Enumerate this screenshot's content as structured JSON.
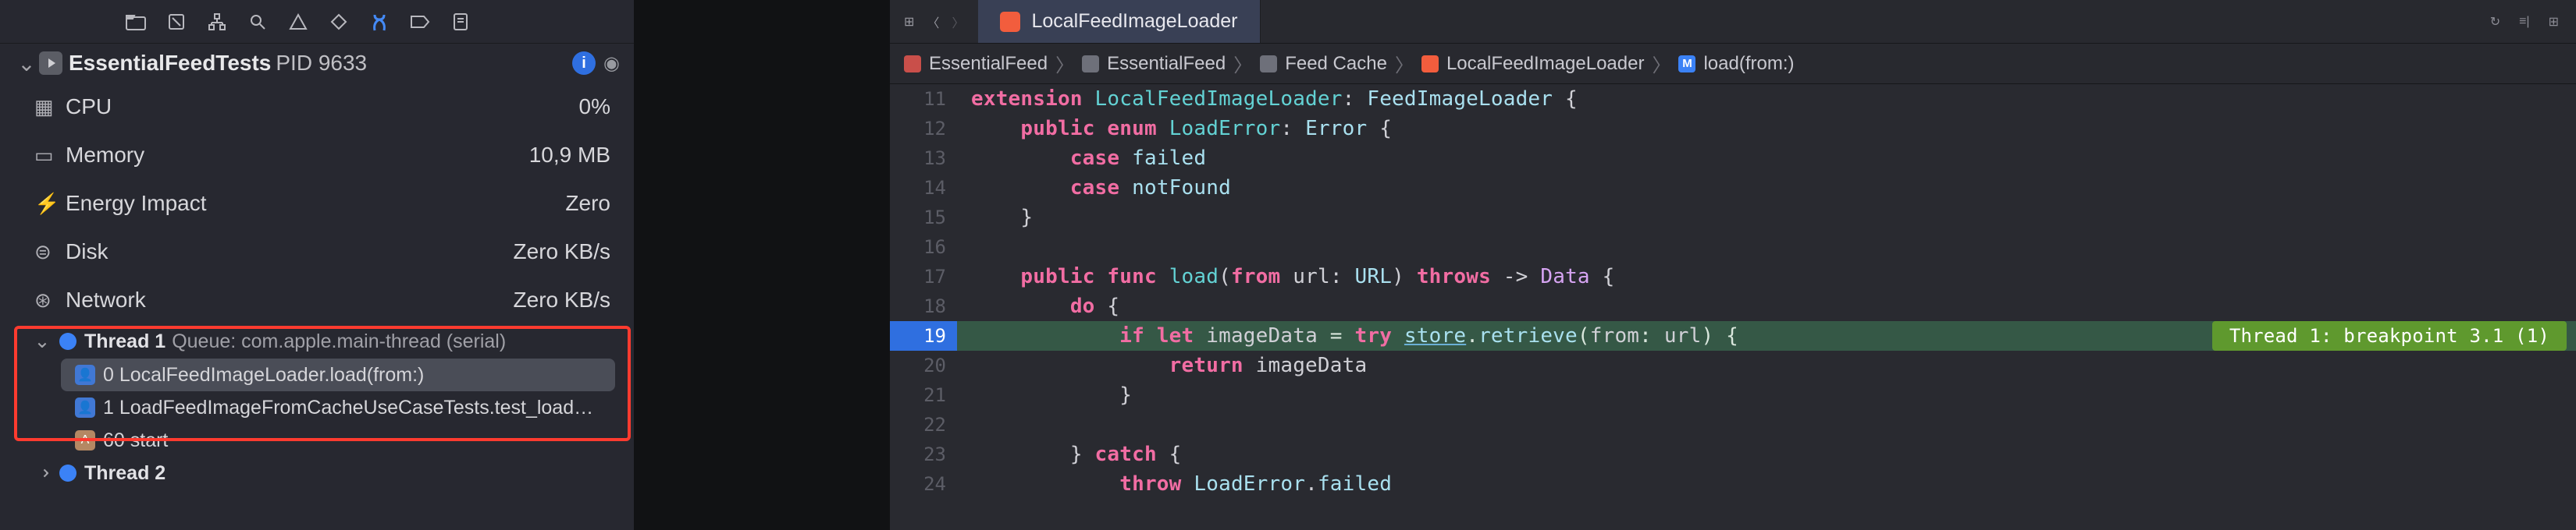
{
  "process": {
    "name": "EssentialFeedTests",
    "pid": "PID 9633",
    "info_badge": "i"
  },
  "gauges": {
    "cpu": {
      "label": "CPU",
      "value": "0%"
    },
    "memory": {
      "label": "Memory",
      "value": "10,9 MB"
    },
    "energy": {
      "label": "Energy Impact",
      "value": "Zero"
    },
    "disk": {
      "label": "Disk",
      "value": "Zero KB/s"
    },
    "network": {
      "label": "Network",
      "value": "Zero KB/s"
    }
  },
  "threads": {
    "t1": {
      "name": "Thread 1",
      "queue": "Queue: com.apple.main-thread (serial)",
      "frames": [
        {
          "idx": "0",
          "label": "LocalFeedImageLoader.load(from:)"
        },
        {
          "idx": "1",
          "label": "LoadFeedImageFromCacheUseCaseTests.test_load…"
        }
      ],
      "start": "60 start"
    },
    "t2": {
      "name": "Thread 2"
    }
  },
  "tab": {
    "filename": "LocalFeedImageLoader"
  },
  "jump": {
    "p0": "EssentialFeed",
    "p1": "EssentialFeed",
    "p2": "Feed Cache",
    "p3": "LocalFeedImageLoader",
    "p4": "load(from:)"
  },
  "breakpoint": {
    "text": "Thread 1: breakpoint 3.1 (1)"
  },
  "lines": {
    "n11": "11",
    "n12": "12",
    "n13": "13",
    "n14": "14",
    "n15": "15",
    "n16": "16",
    "n17": "17",
    "n18": "18",
    "n19": "19",
    "n20": "20",
    "n21": "21",
    "n22": "22",
    "n23": "23",
    "n24": "24"
  },
  "code": {
    "l11_kw": "extension",
    "l11_t1": "LocalFeedImageLoader",
    "l11_t2": "FeedImageLoader",
    "l12_pub": "public",
    "l12_enum": "enum",
    "l12_name": "LoadError",
    "l12_err": "Error",
    "l13_case": "case",
    "l13_name": "failed",
    "l14_case": "case",
    "l14_name": "notFound",
    "l17_pub": "public",
    "l17_func": "func",
    "l17_name": "load",
    "l17_from": "from",
    "l17_url": "url",
    "l17_URL": "URL",
    "l17_throws": "throws",
    "l17_Data": "Data",
    "l18_do": "do",
    "l19_if": "if",
    "l19_let": "let",
    "l19_img": "imageData",
    "l19_try": "try",
    "l19_store": "store",
    "l19_retrieve": "retrieve",
    "l19_from": "from",
    "l19_url": "url",
    "l20_return": "return",
    "l20_img": "imageData",
    "l23_catch": "catch",
    "l24_throw": "throw",
    "l24_LE": "LoadError",
    "l24_failed": "failed"
  }
}
